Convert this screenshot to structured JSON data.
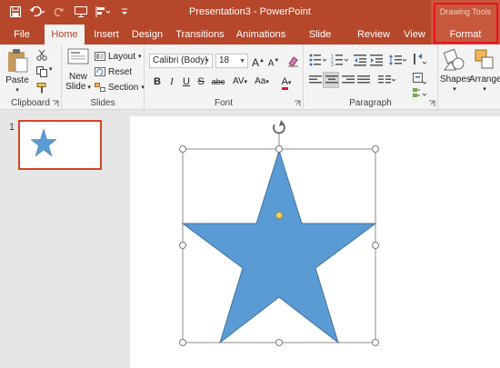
{
  "app": {
    "window_title": "Presentation3 - PowerPoint",
    "contextual_group": "Drawing Tools"
  },
  "tabs": [
    {
      "id": "file",
      "label": "File",
      "active": false
    },
    {
      "id": "home",
      "label": "Home",
      "active": true
    },
    {
      "id": "insert",
      "label": "Insert",
      "active": false
    },
    {
      "id": "design",
      "label": "Design",
      "active": false
    },
    {
      "id": "transitions",
      "label": "Transitions",
      "active": false
    },
    {
      "id": "animations",
      "label": "Animations",
      "active": false
    },
    {
      "id": "slideshow",
      "label": "Slide Show",
      "active": false
    },
    {
      "id": "review",
      "label": "Review",
      "active": false
    },
    {
      "id": "view",
      "label": "View",
      "active": false
    },
    {
      "id": "format",
      "label": "Format",
      "active": false
    }
  ],
  "ribbon": {
    "clipboard": {
      "label": "Clipboard",
      "paste": "Paste"
    },
    "slides": {
      "label": "Slides",
      "new_slide_line1": "New",
      "new_slide_line2": "Slide",
      "layout": "Layout",
      "reset": "Reset",
      "section": "Section"
    },
    "font": {
      "label": "Font",
      "font_name": "Calibri (Body)",
      "font_size": "18",
      "bold": "B",
      "italic": "I",
      "underline": "U",
      "strikethrough": "S",
      "shadow": "abc",
      "spacing": "AV",
      "change_case": "Aa",
      "font_color": "A",
      "grow": "A",
      "shrink": "A"
    },
    "paragraph": {
      "label": "Paragraph"
    },
    "drawing": {
      "shapes": "Shapes",
      "arrange": "Arrange"
    }
  },
  "slides_pane": {
    "slide_number": "1"
  },
  "colors": {
    "accent": "#b7472a",
    "star_fill": "#5b9bd5",
    "thumb_border": "#d24726",
    "highlight": "#e81123"
  }
}
